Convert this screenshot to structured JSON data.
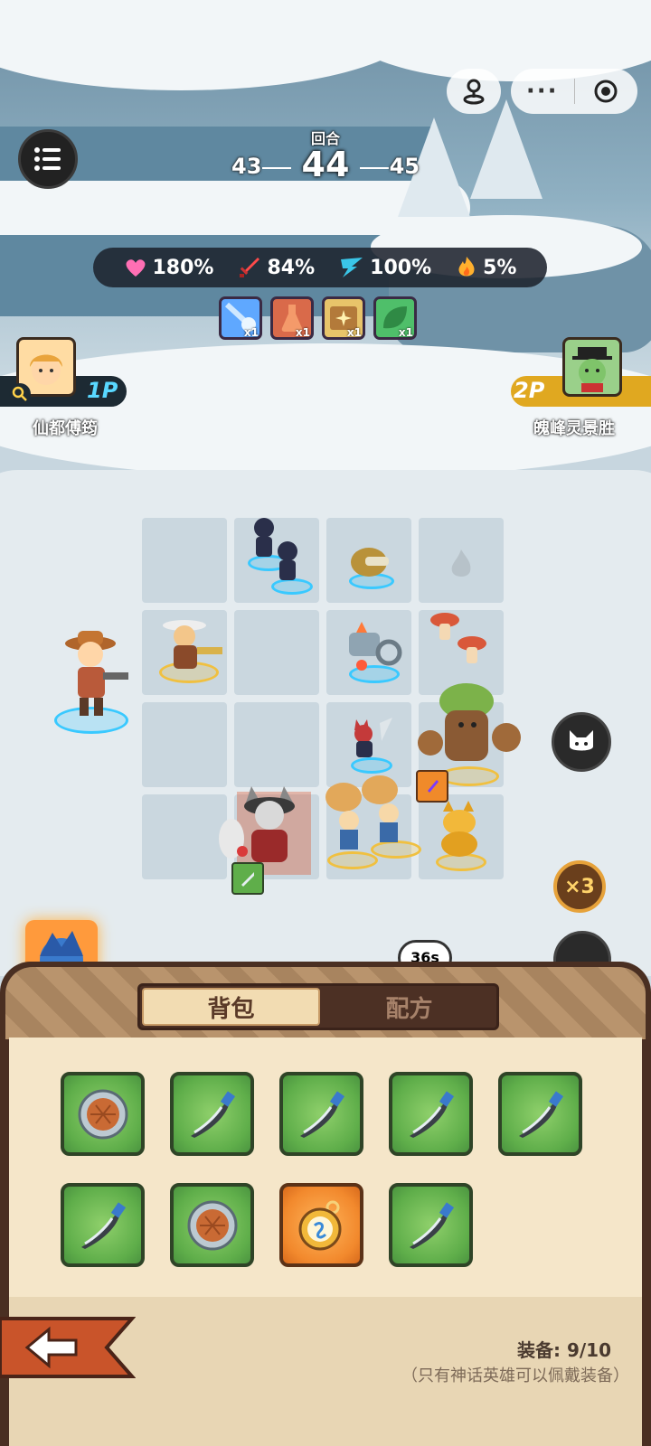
{
  "topbar": {
    "more_glyph": "···",
    "round_label": "回合",
    "round_prev": "43",
    "round_current": "44",
    "round_next": "45"
  },
  "stats": [
    {
      "icon": "heart-icon",
      "value": "180%",
      "color": "#ff6fb4"
    },
    {
      "icon": "sword-icon",
      "value": "84%",
      "color": "#ff4a4a"
    },
    {
      "icon": "speed-icon",
      "value": "100%",
      "color": "#3ac6e8"
    },
    {
      "icon": "fire-icon",
      "value": "5%",
      "color": "#ffb02e"
    }
  ],
  "buffs": [
    {
      "icon": "meteor-buff-icon",
      "count": "x1",
      "color": "#5fa8ff"
    },
    {
      "icon": "flask-buff-icon",
      "count": "x1",
      "color": "#d96a4a"
    },
    {
      "icon": "star-chest-buff-icon",
      "count": "x1",
      "color": "#e8c46a"
    },
    {
      "icon": "leaf-buff-icon",
      "count": "x1",
      "color": "#4fbf6a"
    }
  ],
  "players": {
    "p1": {
      "tag": "1P",
      "name": "仙都傅筠"
    },
    "p2": {
      "tag": "2P",
      "name": "魄峰灵景胜"
    }
  },
  "battle": {
    "speed_label": "×3",
    "timer": "36s"
  },
  "panel": {
    "tabs": [
      {
        "label": "背包",
        "active": true
      },
      {
        "label": "配方",
        "active": false
      }
    ],
    "items": [
      {
        "icon": "shield-item-icon",
        "color": "green"
      },
      {
        "icon": "dagger-item-icon",
        "color": "green"
      },
      {
        "icon": "dagger-item-icon",
        "color": "green"
      },
      {
        "icon": "dagger-item-icon",
        "color": "green"
      },
      {
        "icon": "dagger-item-icon",
        "color": "green"
      },
      {
        "icon": "dagger-item-icon",
        "color": "green"
      },
      {
        "icon": "shield-item-icon",
        "color": "green"
      },
      {
        "icon": "pocket-watch-item-icon",
        "color": "orange"
      },
      {
        "icon": "dagger-item-icon",
        "color": "green"
      }
    ],
    "equip_label": "装备:",
    "equip_count": "9/10",
    "note": "（只有神话英雄可以佩戴装备）"
  }
}
